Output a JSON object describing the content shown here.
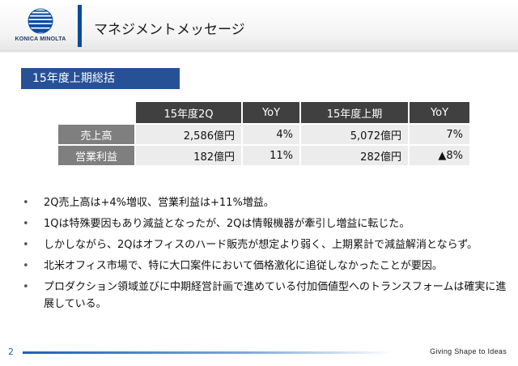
{
  "brand": {
    "company_name": "KONICA MINOLTA",
    "tagline": "Giving Shape to Ideas",
    "colors": {
      "primary_blue": "#275196",
      "divider_blue": "#0b4a9a",
      "header_dark": "#404040",
      "row_label_gray": "#7f7f7f",
      "cell_gray": "#ececec"
    }
  },
  "header": {
    "title": "マネジメントメッセージ"
  },
  "section": {
    "label": "15年度上期総括"
  },
  "results_table": {
    "columns": [
      "15年度2Q",
      "YoY",
      "15年度上期",
      "YoY"
    ],
    "rows": [
      {
        "label": "売上高",
        "values": [
          "2,586億円",
          "4%",
          "5,072億円",
          "7%"
        ]
      },
      {
        "label": "営業利益",
        "values": [
          "182億円",
          "11%",
          "282億円",
          "▲8%"
        ]
      }
    ]
  },
  "bullets": {
    "marker": "•",
    "items": [
      "2Q売上高は+4%増収、営業利益は+11%増益。",
      "1Qは特殊要因もあり減益となったが、2Qは情報機器が牽引し増益に転じた。",
      "しかしながら、2Qはオフィスのハード販売が想定より弱く、上期累計で減益解消とならず。",
      "北米オフィス市場で、特に大口案件において価格激化に追従しなかったことが要因。",
      "プロダクション領域並びに中期経営計画で進めている付加価値型へのトランスフォームは確実に進展している。"
    ]
  },
  "footer": {
    "page_number": "2"
  }
}
